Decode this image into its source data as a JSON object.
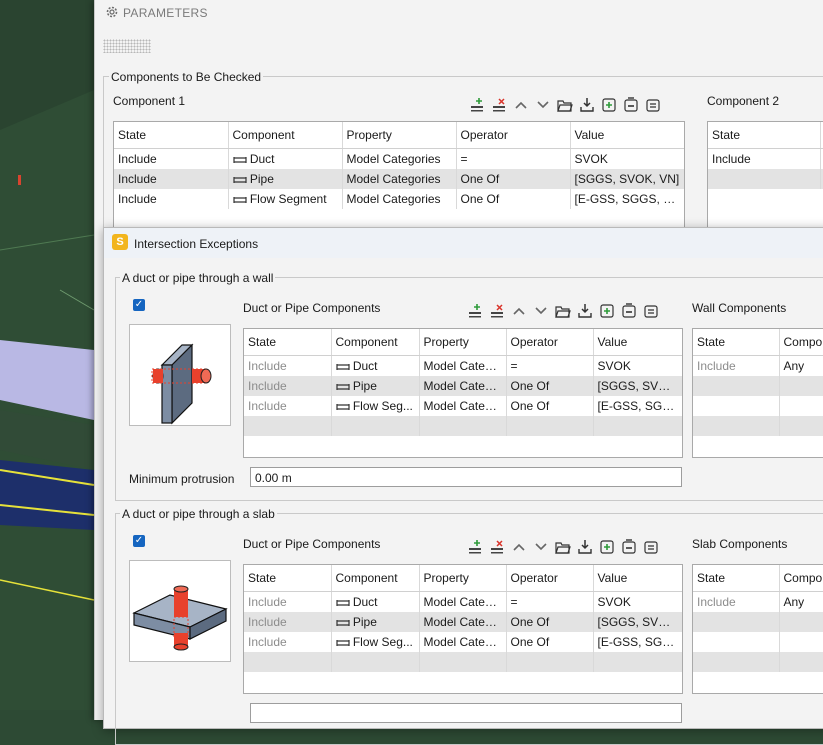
{
  "window": {
    "title": "PARAMETERS"
  },
  "components_group": {
    "legend": "Components to Be Checked",
    "component1": {
      "title": "Component 1",
      "columns": [
        "State",
        "Component",
        "Property",
        "Operator",
        "Value"
      ],
      "rows": [
        {
          "state": "Include",
          "component": "Duct",
          "property": "Model Categories",
          "operator": "=",
          "value": "SVOK"
        },
        {
          "state": "Include",
          "component": "Pipe",
          "property": "Model Categories",
          "operator": "One Of",
          "value": "[SGGS, SVOK, VN]"
        },
        {
          "state": "Include",
          "component": "Flow Segment",
          "property": "Model Categories",
          "operator": "One Of",
          "value": "[E-GSS, SGGS, SVO..."
        }
      ]
    },
    "component2": {
      "title": "Component 2",
      "columns": [
        "State"
      ],
      "rows": [
        {
          "state": "Include"
        }
      ]
    }
  },
  "dialog": {
    "title": "Intersection Exceptions",
    "wall_section": {
      "legend": "A duct or pipe through a wall",
      "checked": true,
      "left_title": "Duct or Pipe Components",
      "right_title": "Wall Components",
      "columns": [
        "State",
        "Component",
        "Property",
        "Operator",
        "Value"
      ],
      "rows": [
        {
          "state": "Include",
          "component": "Duct",
          "property": "Model Catego...",
          "operator": "=",
          "value": "SVOK"
        },
        {
          "state": "Include",
          "component": "Pipe",
          "property": "Model Catego...",
          "operator": "One Of",
          "value": "[SGGS, SVOK, ..."
        },
        {
          "state": "Include",
          "component": "Flow Seg...",
          "property": "Model Catego...",
          "operator": "One Of",
          "value": "[E-GSS, SGGS, ..."
        }
      ],
      "right_columns": [
        "State",
        "Compo"
      ],
      "right_rows": [
        {
          "state": "Include",
          "component": "Any"
        }
      ],
      "protrusion_label": "Minimum protrusion",
      "protrusion_value": "0.00 m"
    },
    "slab_section": {
      "legend": "A duct or pipe through a slab",
      "checked": true,
      "left_title": "Duct or Pipe Components",
      "right_title": "Slab Components",
      "columns": [
        "State",
        "Component",
        "Property",
        "Operator",
        "Value"
      ],
      "rows": [
        {
          "state": "Include",
          "component": "Duct",
          "property": "Model Catego...",
          "operator": "=",
          "value": "SVOK"
        },
        {
          "state": "Include",
          "component": "Pipe",
          "property": "Model Catego...",
          "operator": "One Of",
          "value": "[SGGS, SVOK, ..."
        },
        {
          "state": "Include",
          "component": "Flow Seg...",
          "property": "Model Catego...",
          "operator": "One Of",
          "value": "[E-GSS, SGGS, ..."
        }
      ],
      "right_columns": [
        "State",
        "Compo"
      ],
      "right_rows": [
        {
          "state": "Include",
          "component": "Any"
        }
      ]
    }
  },
  "colors": {
    "accent": "#1565c0",
    "add": "#2e9b3a",
    "remove": "#d9342b",
    "dialog_icon": "#f2b51d",
    "pipe": "#e8412c",
    "wall": "#7d8da3"
  },
  "icons": [
    "gear-icon",
    "add-row-icon",
    "delete-row-icon",
    "move-up-icon",
    "move-down-icon",
    "open-folder-icon",
    "import-icon",
    "add-group-icon",
    "remove-group-icon",
    "clear-icon",
    "duct-icon",
    "checkbox-icon"
  ]
}
